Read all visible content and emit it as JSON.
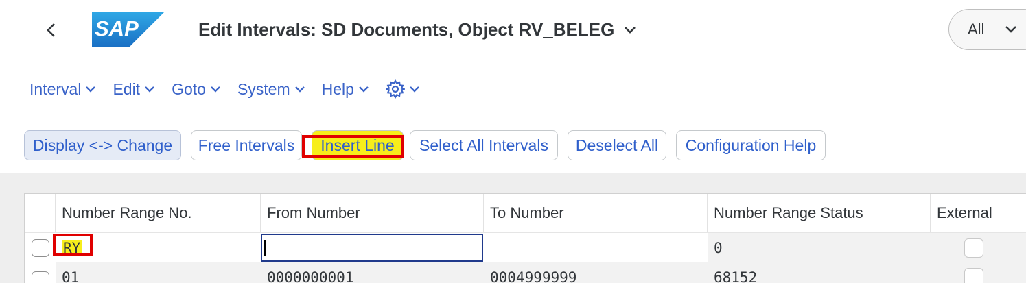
{
  "header": {
    "back_icon": "chevron-left-icon",
    "logo_text": "SAP",
    "title": "Edit Intervals: SD Documents, Object RV_BELEG",
    "title_icon": "chevron-down-icon",
    "search_scope": "All"
  },
  "menu": {
    "items": [
      {
        "label": "Interval"
      },
      {
        "label": "Edit"
      },
      {
        "label": "Goto"
      },
      {
        "label": "System"
      },
      {
        "label": "Help"
      }
    ],
    "settings_icon": "gear-icon"
  },
  "toolbar": {
    "display_change": "Display <-> Change",
    "free_intervals": "Free Intervals",
    "insert_line": "Insert Line",
    "select_all": "Select All Intervals",
    "deselect_all": "Deselect All",
    "config_help": "Configuration Help"
  },
  "table": {
    "columns": [
      "Number Range No.",
      "From Number",
      "To Number",
      "Number Range Status",
      "External"
    ],
    "rows": [
      {
        "no": "RY",
        "from": "",
        "to": "",
        "status": "0"
      },
      {
        "no": "01",
        "from": "0000000001",
        "to": "0004999999",
        "status": "68152"
      }
    ]
  },
  "colors": {
    "link_blue": "#3a63c8",
    "highlight_red": "#e00000",
    "highlight_yellow": "#f7ee1b",
    "input_focus": "#203a8c"
  }
}
